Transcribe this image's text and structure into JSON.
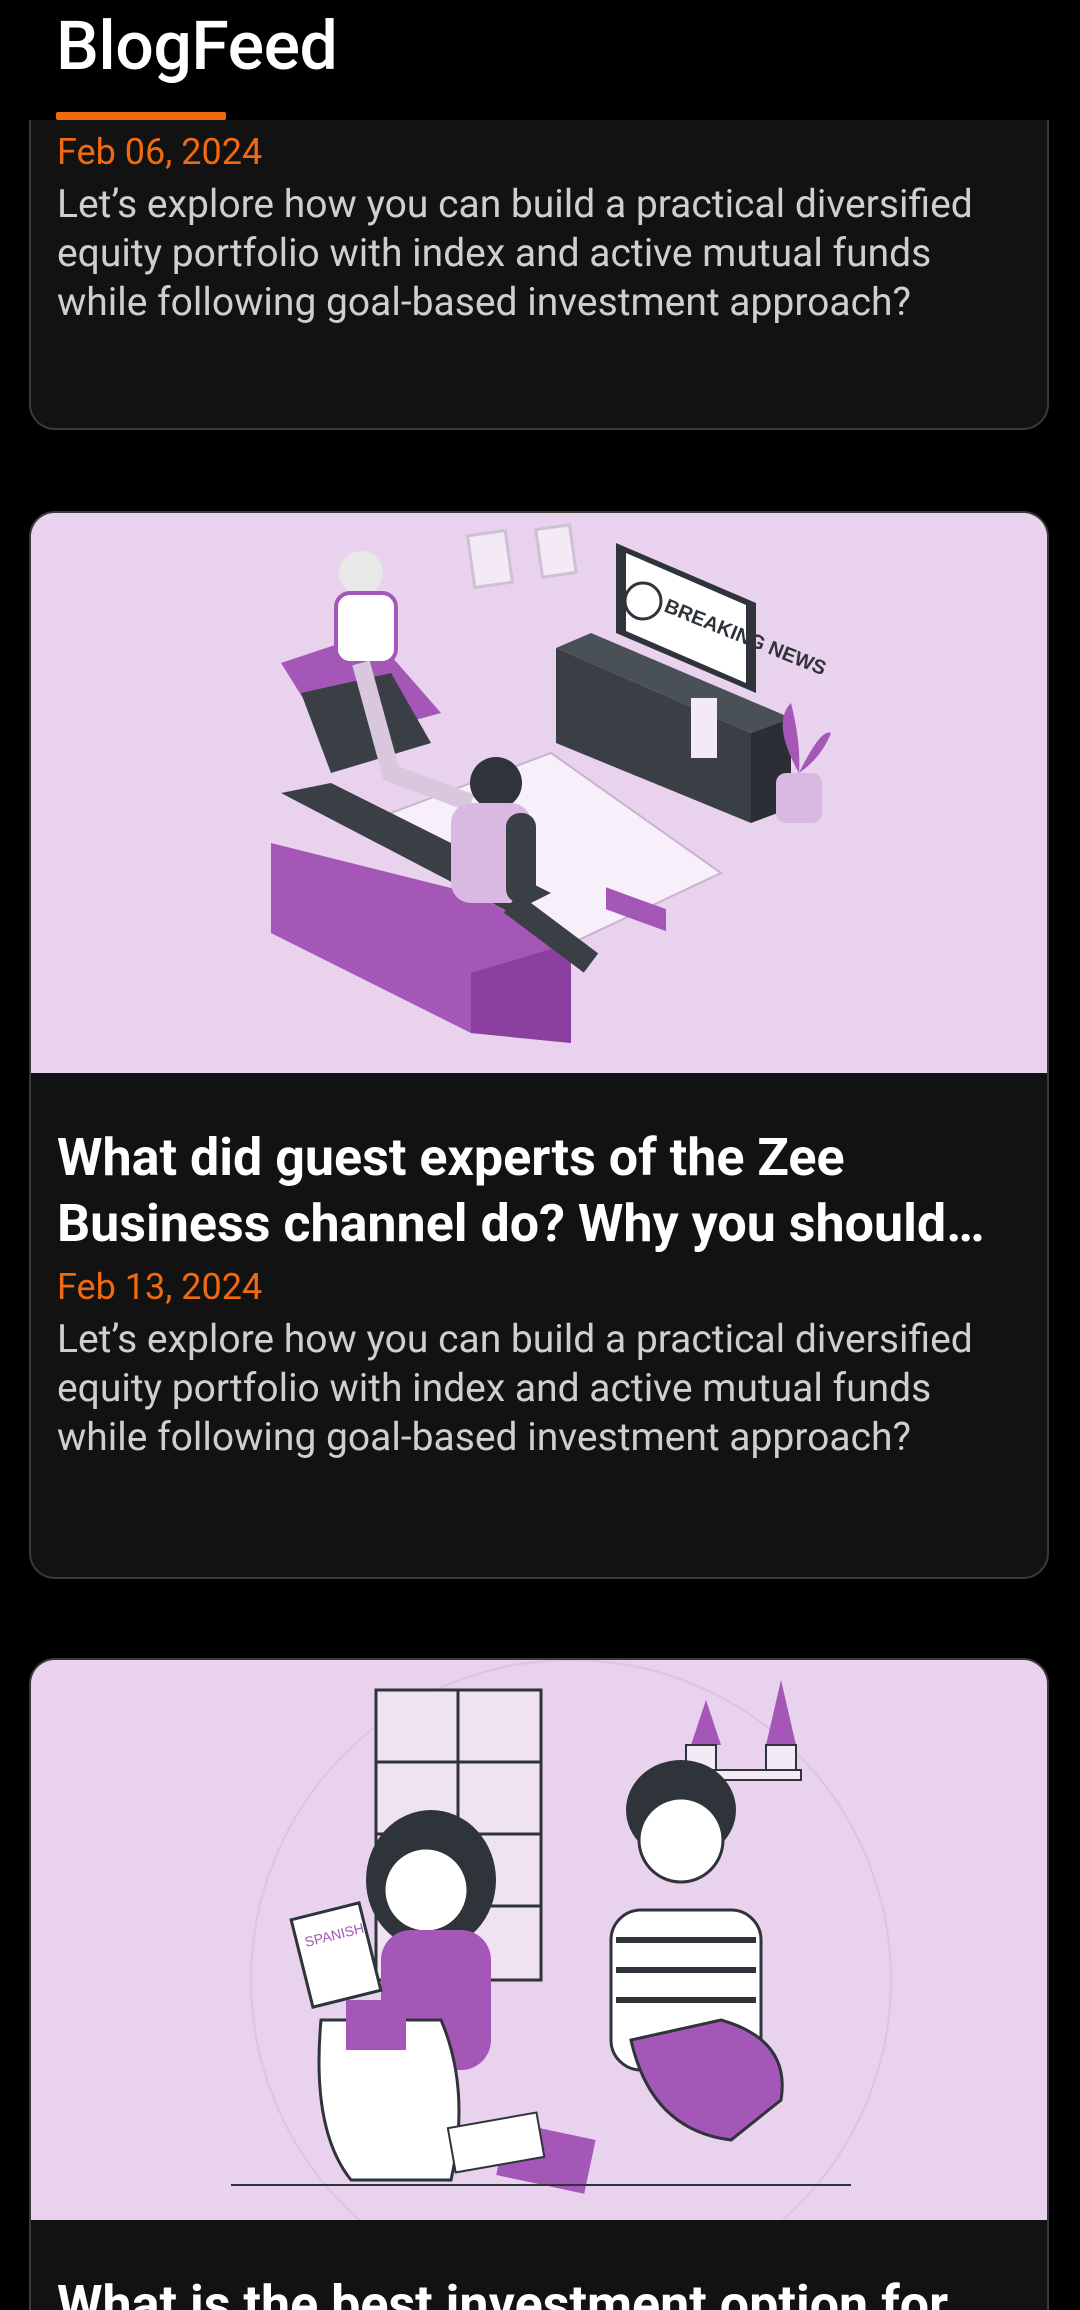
{
  "app": {
    "title": "BlogFeed",
    "accent": "#f26a0f"
  },
  "posts": [
    {
      "title": "",
      "date": "Feb 06, 2024",
      "excerpt": "Let’s explore how you can build a practical diversified equity portfolio with index and active mutual funds while following goal-based investment approach?"
    },
    {
      "title": "What did guest experts of the Zee Business channel do? Why you should…",
      "date": "Feb 13, 2024",
      "excerpt": "Let’s explore how you can build a practical diversified equity portfolio with index and active mutual funds while following goal-based investment approach?",
      "image_icon": "breaking-news-illustration",
      "image_text": "BREAKING NEWS"
    },
    {
      "title": "What is the best investment option for",
      "image_icon": "students-study-illustration",
      "image_text": "SPANISH"
    }
  ]
}
